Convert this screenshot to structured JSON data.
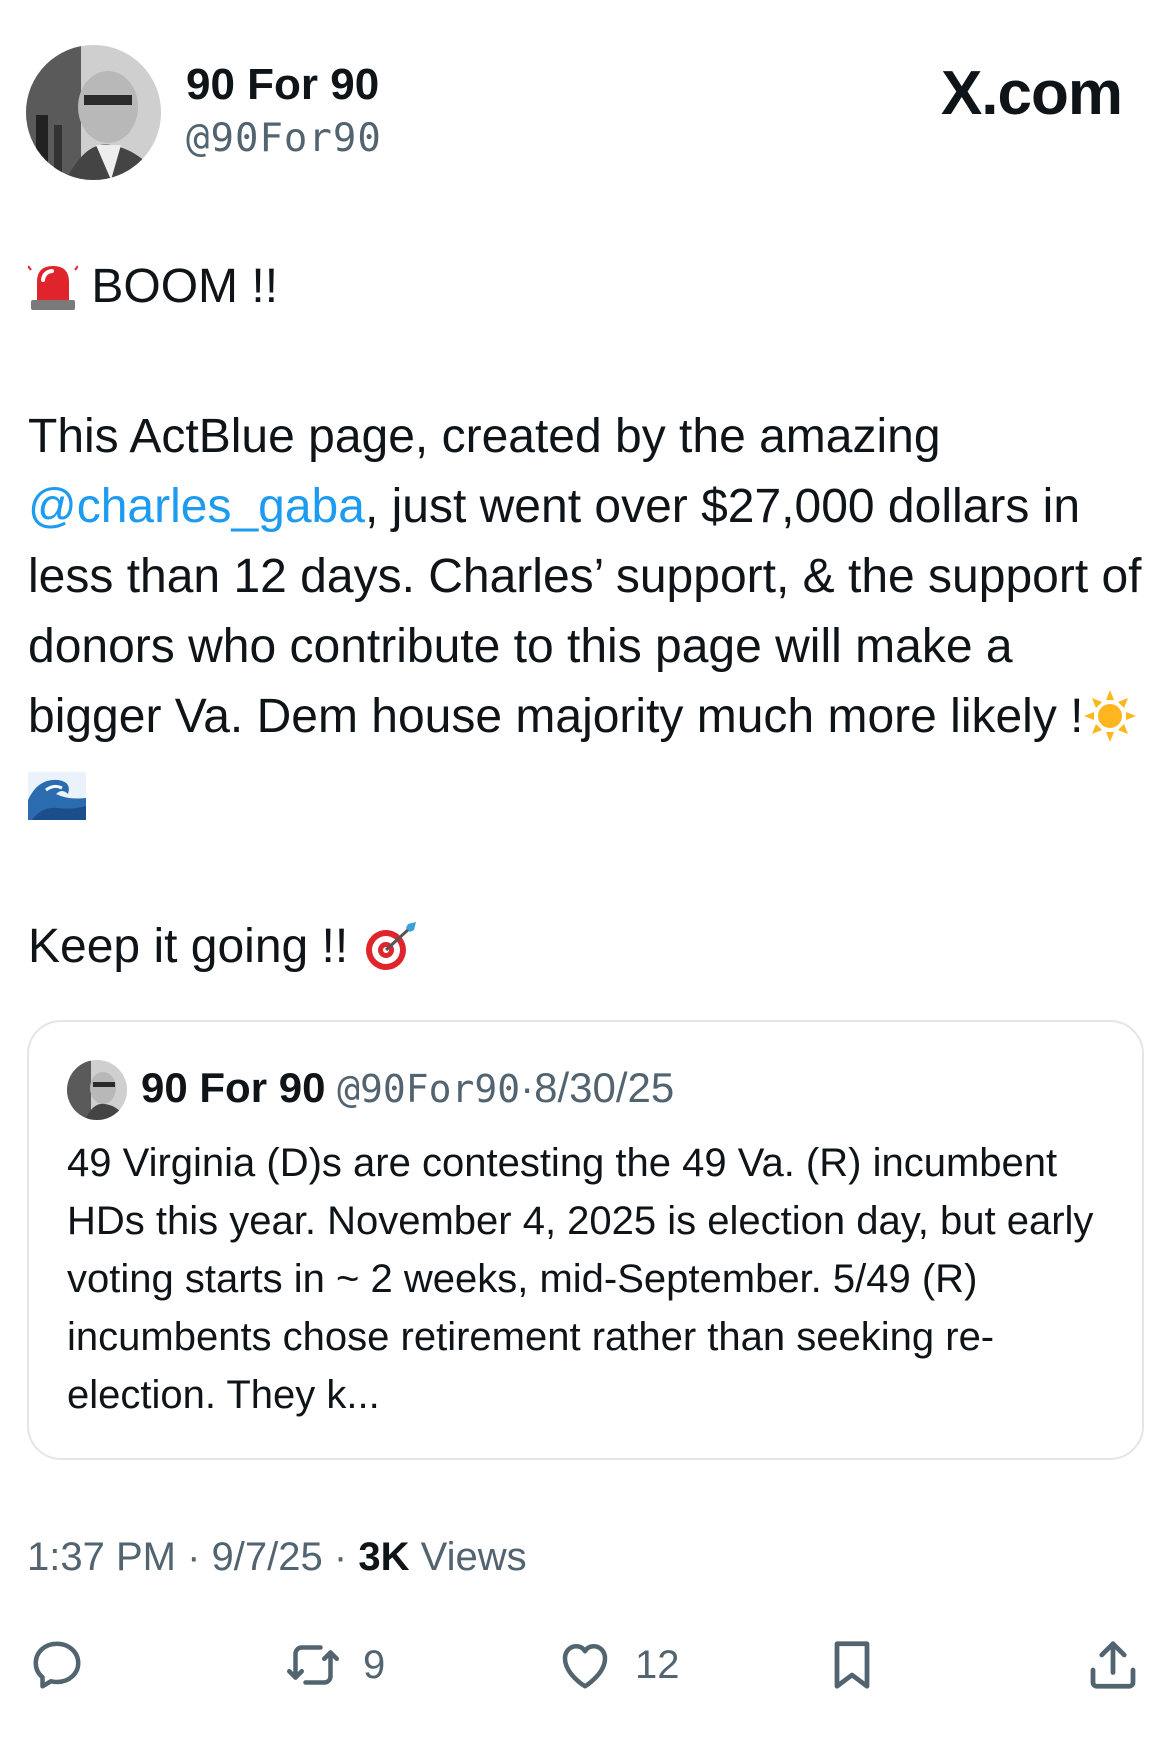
{
  "author": {
    "name": "90 For 90",
    "handle": "@90For90"
  },
  "brand": "X.com",
  "tweet": {
    "headline": "BOOM !!",
    "paragraph_before_mention": "This ActBlue page, created by the amazing ",
    "mention": "@charles_gaba",
    "paragraph_after_mention": ", just went over $27,000 dollars in less than 12 days. Charles’ support, & the support of donors who contribute to this page will make a bigger Va. Dem house majority much more likely !",
    "closing": "Keep it going !!",
    "icons": [
      "police-light-icon",
      "sun-icon",
      "wave-icon",
      "dart-target-icon"
    ]
  },
  "quote": {
    "name": "90 For 90",
    "handle": "@90For90",
    "separator": "·",
    "date": "8/30/25",
    "text": "49 Virginia (D)s are contesting the 49 Va. (R) incumbent HDs this year. November 4, 2025 is election day, but early voting starts in ~ 2 weeks, mid-September. 5/49 (R) incumbents chose retirement rather than seeking re-election. They k..."
  },
  "meta": {
    "time": "1:37 PM",
    "separator": "·",
    "date": "9/7/25",
    "views_count": "3K",
    "views_label": "Views"
  },
  "actions": {
    "reposts": "9",
    "likes": "12"
  },
  "colors": {
    "text": "#0f1419",
    "secondary": "#536471",
    "link": "#1d9bf0",
    "border": "#e1e6ea"
  }
}
